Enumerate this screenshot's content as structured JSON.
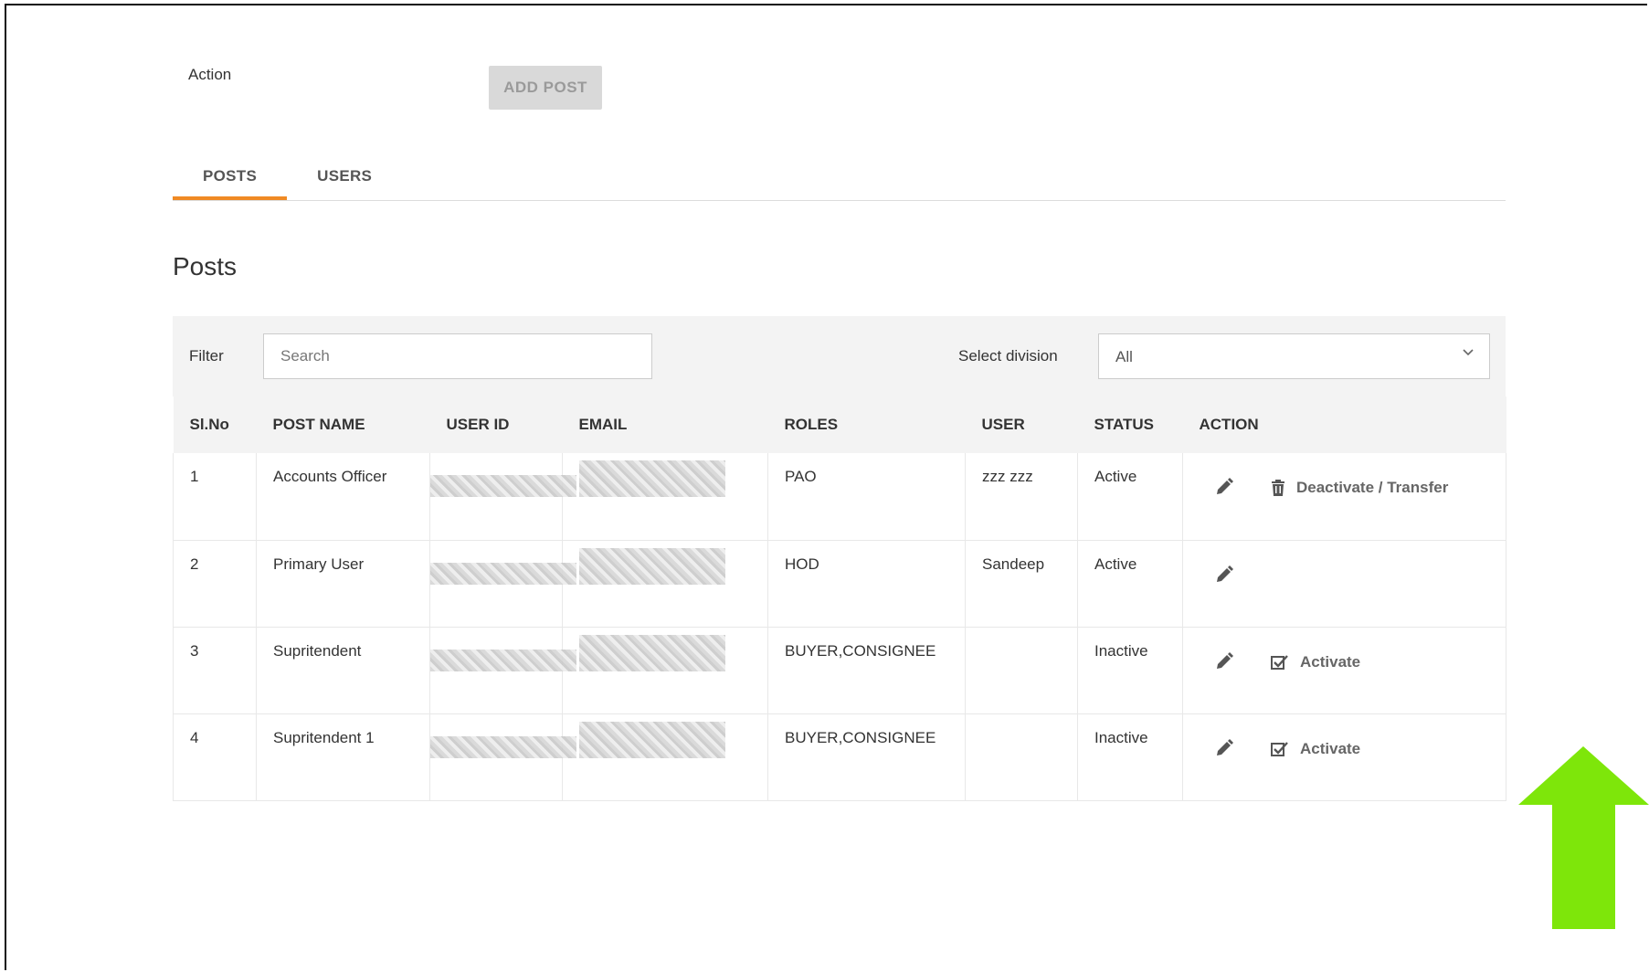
{
  "header": {
    "action_label": "Action",
    "add_post_label": "ADD POST"
  },
  "tabs": [
    {
      "label": "POSTS",
      "active": true
    },
    {
      "label": "USERS",
      "active": false
    }
  ],
  "section_title": "Posts",
  "filter": {
    "label": "Filter",
    "search_placeholder": "Search",
    "division_label": "Select division",
    "division_value": "All"
  },
  "table": {
    "columns": [
      "Sl.No",
      "POST NAME",
      "USER ID",
      "EMAIL",
      "ROLES",
      "USER",
      "STATUS",
      "ACTION"
    ],
    "rows": [
      {
        "sl": "1",
        "post_name": "Accounts Officer",
        "roles": "PAO",
        "user": "zzz zzz",
        "status": "Active",
        "action_label": "Deactivate / Transfer",
        "action_icon": "trash-icon"
      },
      {
        "sl": "2",
        "post_name": "Primary User",
        "roles": "HOD",
        "user": "Sandeep",
        "status": "Active",
        "action_label": "",
        "action_icon": ""
      },
      {
        "sl": "3",
        "post_name": "Supritendent",
        "roles": "BUYER,CONSIGNEE",
        "user": "",
        "status": "Inactive",
        "action_label": "Activate",
        "action_icon": "checkbox-icon"
      },
      {
        "sl": "4",
        "post_name": "Supritendent 1",
        "roles": "BUYER,CONSIGNEE",
        "user": "",
        "status": "Inactive",
        "action_label": "Activate",
        "action_icon": "checkbox-icon"
      }
    ]
  },
  "colors": {
    "tab_active_underline": "#f08a24",
    "annotation_arrow": "#7ee60a"
  }
}
